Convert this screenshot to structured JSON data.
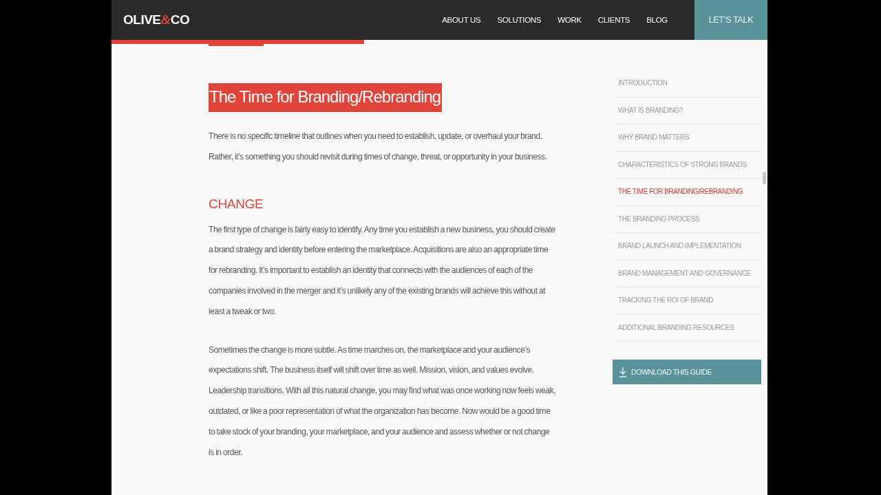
{
  "header": {
    "logo": {
      "start": "OLIVE",
      "ampersand": "&",
      "end": "CO"
    },
    "nav": [
      {
        "label": "ABOUT US",
        "kind": "link"
      },
      {
        "label": "SOLUTIONS",
        "kind": "link"
      },
      {
        "label": "WORK",
        "kind": "link"
      },
      {
        "label": "CLIENTS",
        "kind": "link"
      },
      {
        "label": "BLOG",
        "kind": "link"
      },
      {
        "label": "LET’S TALK",
        "kind": "cta"
      }
    ]
  },
  "article": {
    "title": "The Time for Branding/Rebranding",
    "blocks": [
      {
        "kind": "paragraph",
        "text": "There is no specific timeline that outlines when you need to establish, update, or overhaul your brand. Rather, it’s something you should revisit during times of change, threat, or opportunity in your business."
      },
      {
        "kind": "subheading",
        "text": "CHANGE"
      },
      {
        "kind": "paragraph",
        "text": "The first type of change is fairly easy to identify. Any time you establish a new business, you should create a brand strategy and identity before entering the marketplace. Acquisitions are also an appropriate time for rebranding. It’s important to establish an identity that connects with the audiences of each of the companies involved in the merger and it’s unlikely any of the existing brands will achieve this without at least a tweak or two."
      },
      {
        "kind": "paragraph",
        "text": "Sometimes the change is more subtle. As time marches on, the marketplace and your audience’s expectations shift. The business itself will shift over time as well. Mission, vision, and values evolve. Leadership transitions. With all this natural change, you may find what was once working now feels weak, outdated, or like a poor representation of what the organization has become. Now would be a good time to take stock of your branding, your marketplace, and your audience and assess whether or not change is in order."
      }
    ]
  },
  "toc": {
    "items": [
      {
        "label": "INTRODUCTION",
        "selected": false
      },
      {
        "label": "WHAT IS BRANDING?",
        "selected": false
      },
      {
        "label": "WHY BRAND MATTERS",
        "selected": false
      },
      {
        "label": "CHARACTERISTICS OF STRONG BRANDS",
        "selected": false
      },
      {
        "label": "THE TIME FOR BRANDING/REBRANDING",
        "selected": true
      },
      {
        "label": "THE BRANDING PROCESS",
        "selected": false
      },
      {
        "label": "BRAND LAUNCH AND IMPLEMENTATION",
        "selected": false
      },
      {
        "label": "BRAND MANAGEMENT AND GOVERNANCE",
        "selected": false
      },
      {
        "label": "TRACKING THE ROI OF BRAND",
        "selected": false
      },
      {
        "label": "ADDITIONAL BRANDING RESOURCES",
        "selected": false
      }
    ],
    "download_button": "DOWNLOAD THIS GUIDE"
  }
}
